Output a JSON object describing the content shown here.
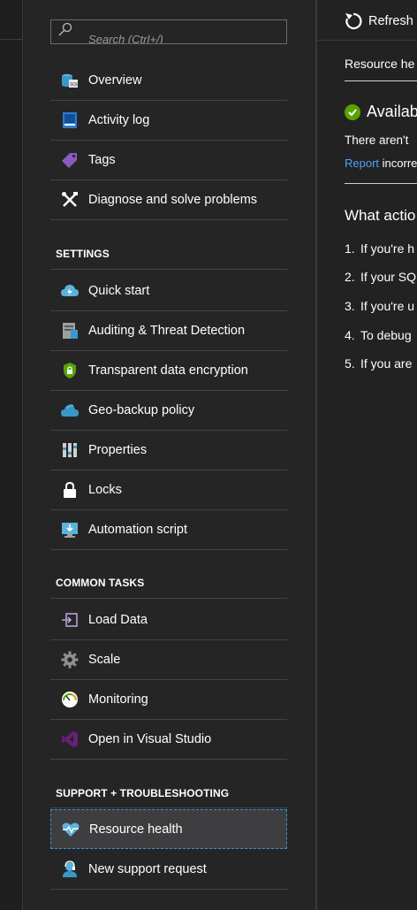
{
  "search": {
    "placeholder": "Search (Ctrl+/)"
  },
  "menu": {
    "top_items": [
      {
        "label": "Overview",
        "icon": "sql-database-icon"
      },
      {
        "label": "Activity log",
        "icon": "activity-log-icon"
      },
      {
        "label": "Tags",
        "icon": "tag-icon"
      },
      {
        "label": "Diagnose and solve problems",
        "icon": "tools-icon"
      }
    ],
    "settings": {
      "heading": "SETTINGS",
      "items": [
        {
          "label": "Quick start",
          "icon": "cloud-bolt-icon"
        },
        {
          "label": "Auditing & Threat Detection",
          "icon": "audit-icon"
        },
        {
          "label": "Transparent data encryption",
          "icon": "shield-lock-icon"
        },
        {
          "label": "Geo-backup policy",
          "icon": "cloud-icon"
        },
        {
          "label": "Properties",
          "icon": "properties-icon"
        },
        {
          "label": "Locks",
          "icon": "lock-icon"
        },
        {
          "label": "Automation script",
          "icon": "monitor-download-icon"
        }
      ]
    },
    "common_tasks": {
      "heading": "COMMON TASKS",
      "items": [
        {
          "label": "Load Data",
          "icon": "load-data-icon"
        },
        {
          "label": "Scale",
          "icon": "gear-icon"
        },
        {
          "label": "Monitoring",
          "icon": "gauge-icon"
        },
        {
          "label": "Open in Visual Studio",
          "icon": "visual-studio-icon"
        }
      ]
    },
    "support": {
      "heading": "SUPPORT + TROUBLESHOOTING",
      "items": [
        {
          "label": "Resource health",
          "icon": "heart-pulse-icon",
          "selected": true
        },
        {
          "label": "New support request",
          "icon": "support-person-icon"
        }
      ]
    }
  },
  "content": {
    "toolbar": {
      "refresh_label": "Refresh"
    },
    "breadcrumb": "Resource he",
    "status": {
      "text": "Availab",
      "color": "#57a300"
    },
    "description": "There aren't",
    "report": {
      "link": "Report",
      "rest": "incorre"
    },
    "what_heading": "What actio",
    "steps": [
      {
        "n": "1.",
        "text": "If you're h"
      },
      {
        "n": "2.",
        "text": "If your SQ"
      },
      {
        "n": "3.",
        "text": "If you're u"
      },
      {
        "n": "4.",
        "text": "To debug"
      },
      {
        "n": "5.",
        "text": "If you are"
      }
    ]
  },
  "colors": {
    "accent": "#2e96d8",
    "link": "#4fa0ff",
    "selected_bg": "#3e3e40"
  }
}
